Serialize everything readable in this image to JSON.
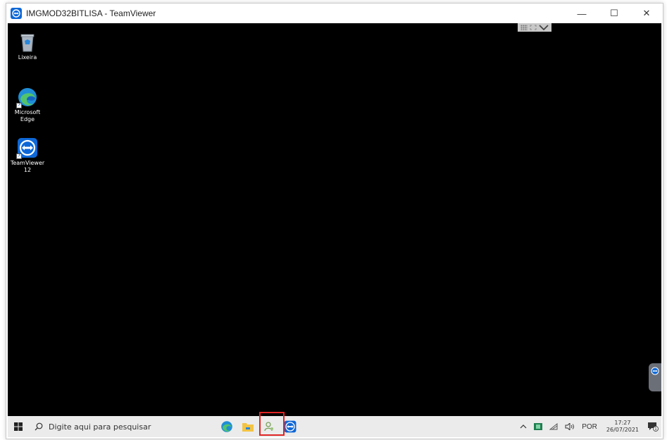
{
  "window": {
    "title": "IMGMOD32BITLISA - TeamViewer",
    "controls": {
      "minimize": "—",
      "maximize": "☐",
      "close": "✕"
    }
  },
  "desktop": {
    "icons": [
      {
        "label": "Lixeira",
        "icon": "recycle-bin-icon"
      },
      {
        "label": "Microsoft\nEdge",
        "icon": "edge-icon"
      },
      {
        "label": "TeamViewer\n12",
        "icon": "teamviewer-icon"
      }
    ]
  },
  "taskbar": {
    "search_placeholder": "Digite aqui para pesquisar",
    "apps": [
      "edge-icon",
      "file-explorer-icon",
      "user-app-icon",
      "teamviewer-icon"
    ],
    "tray": {
      "language": "POR",
      "time": "17:27",
      "date": "26/07/2021",
      "notification_count": "1"
    }
  },
  "colors": {
    "teamviewer_blue": "#0e67d6",
    "remote_background": "#000000",
    "taskbar": "#ebebeb",
    "highlight": "#e02424"
  }
}
